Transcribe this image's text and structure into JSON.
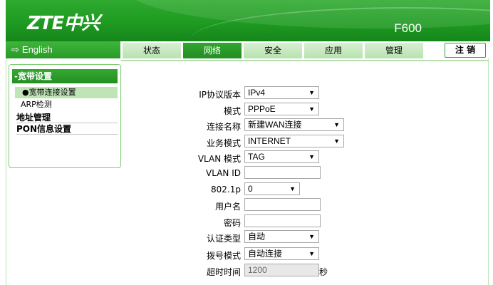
{
  "header": {
    "logo": "ZTE中兴",
    "model": "F600"
  },
  "nav": {
    "language": "English",
    "tabs": [
      {
        "label": "状态",
        "active": false
      },
      {
        "label": "网络",
        "active": true
      },
      {
        "label": "安全",
        "active": false
      },
      {
        "label": "应用",
        "active": false
      },
      {
        "label": "管理",
        "active": false
      }
    ],
    "logout": "注 销"
  },
  "sidebar": {
    "section": "-宽带设置",
    "subitems": [
      "●宽带连接设置",
      "ARP检测"
    ],
    "items": [
      "地址管理",
      "PON信息设置"
    ]
  },
  "form": {
    "ip_version": {
      "label": "IP协议版本",
      "value": "IPv4"
    },
    "mode": {
      "label": "模式",
      "value": "PPPoE"
    },
    "connection_name": {
      "label": "连接名称",
      "value": "新建WAN连接"
    },
    "service_mode": {
      "label": "业务模式",
      "value": "INTERNET"
    },
    "vlan_mode": {
      "label": "VLAN 模式",
      "value": "TAG"
    },
    "vlan_id": {
      "label": "VLAN ID",
      "value": ""
    },
    "dot1p": {
      "label": "802.1p",
      "value": "0"
    },
    "username": {
      "label": "用户名",
      "value": ""
    },
    "password": {
      "label": "密码",
      "value": ""
    },
    "auth_type": {
      "label": "认证类型",
      "value": "自动"
    },
    "dial_mode": {
      "label": "拨号模式",
      "value": "自动连接"
    },
    "timeout": {
      "label": "超时时间",
      "value": "1200",
      "unit": "秒"
    }
  },
  "colors": {
    "brand_green": "#1f9a22",
    "active_tab": "#238e22",
    "tab_light": "#c6e8bf"
  }
}
